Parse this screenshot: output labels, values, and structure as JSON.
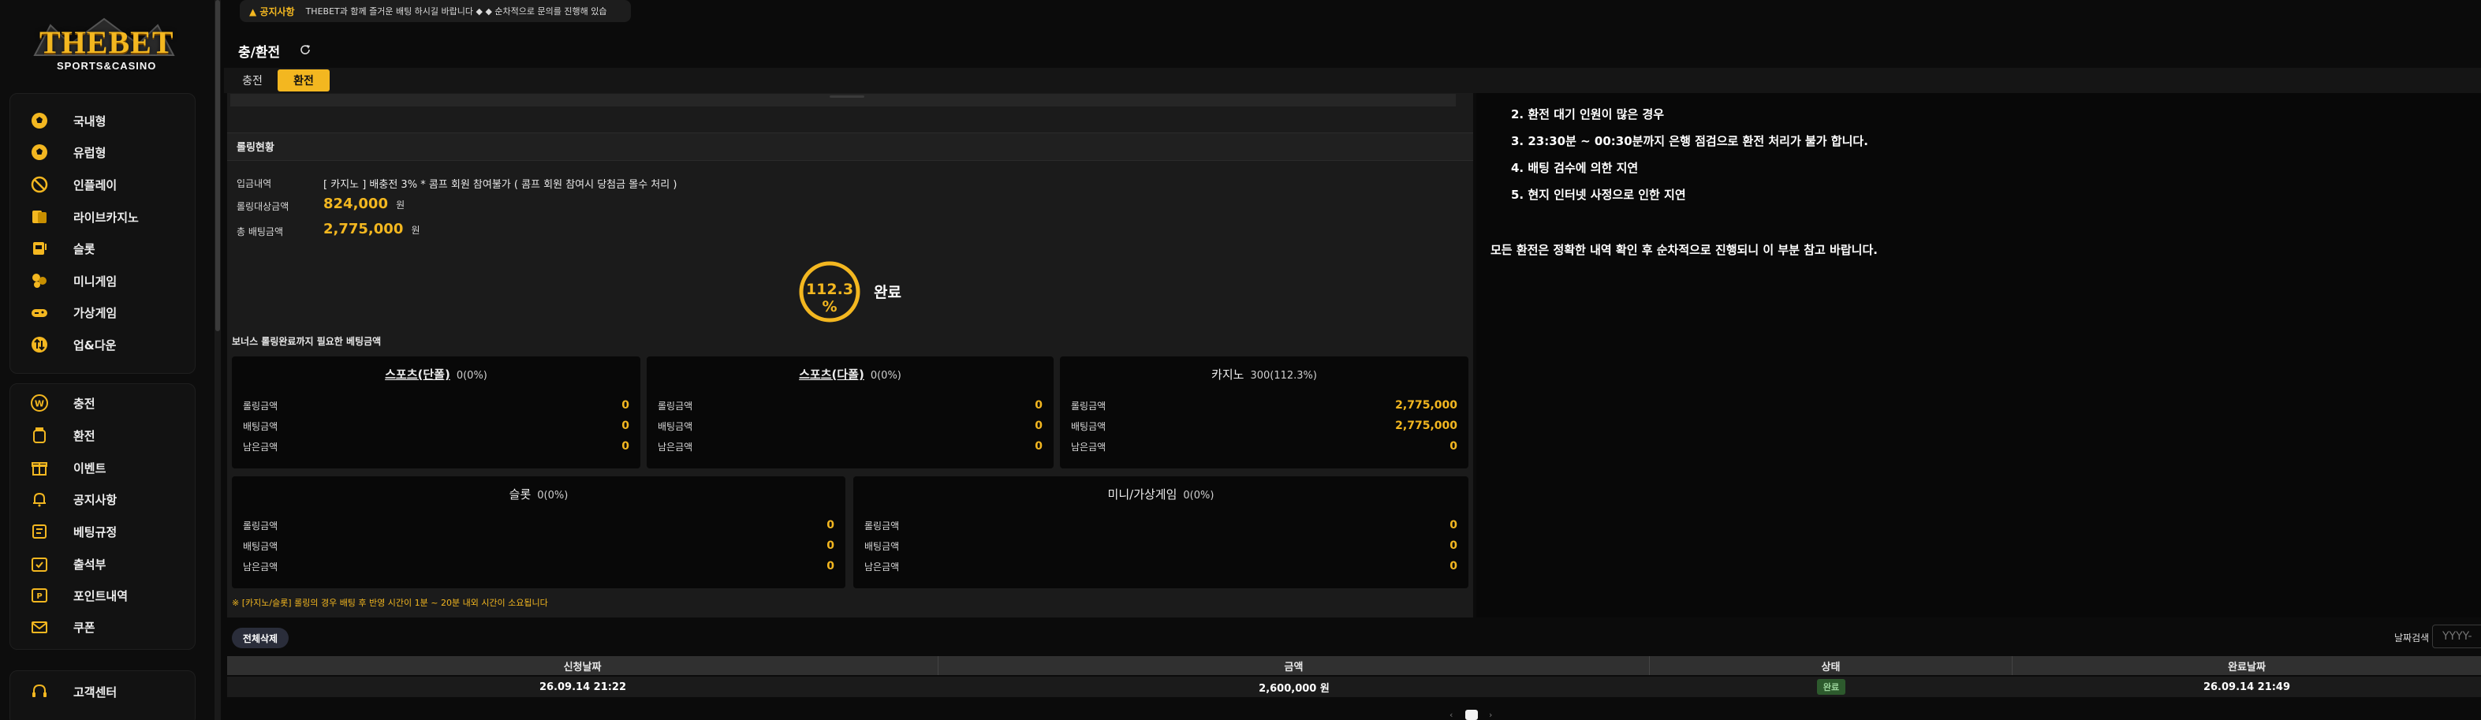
{
  "logo": {
    "title": "THEBET",
    "subtitle": "SPORTS&CASINO"
  },
  "sidebar": {
    "games": [
      {
        "label": "국내형",
        "icon": "soccer-ball-icon"
      },
      {
        "label": "유럽형",
        "icon": "soccer-ball-icon"
      },
      {
        "label": "인플레이",
        "icon": "no-sign-icon"
      },
      {
        "label": "라이브카지노",
        "icon": "cards-icon"
      },
      {
        "label": "슬롯",
        "icon": "slot-icon"
      },
      {
        "label": "미니게임",
        "icon": "balls-icon"
      },
      {
        "label": "가상게임",
        "icon": "gamepad-icon"
      },
      {
        "label": "업&다운",
        "icon": "updown-icon"
      }
    ],
    "account": [
      {
        "label": "충전",
        "icon": "won-coin-icon"
      },
      {
        "label": "환전",
        "icon": "jar-icon"
      },
      {
        "label": "이벤트",
        "icon": "gift-icon"
      },
      {
        "label": "공지사항",
        "icon": "bell-icon"
      },
      {
        "label": "베팅규정",
        "icon": "rules-icon"
      },
      {
        "label": "출석부",
        "icon": "calendar-check-icon"
      },
      {
        "label": "포인트내역",
        "icon": "point-icon"
      },
      {
        "label": "쿠폰",
        "icon": "mail-icon"
      }
    ],
    "support": [
      {
        "label": "고객센터",
        "icon": "headset-icon"
      }
    ]
  },
  "notice": {
    "tag": "공지사항",
    "text": "THEBET과 함께 즐거운 배팅 하시길 바랍니다 ◆ ◆ 순차적으로 문의를 진행해 있습"
  },
  "page": {
    "title": "충/환전",
    "tabs": {
      "deposit": "충전",
      "withdraw": "환전"
    }
  },
  "rolling": {
    "title": "롤링현황",
    "deposit_label": "입금내역",
    "deposit_value": "[ 카지노 ] 배충전 3% * 콤프 회원 참여불가 ( 콤프 회원 참여시 당첨금 몰수 처리 )",
    "target_label": "롤링대상금액",
    "target_value": "824,000",
    "total_label": "총 배팅금액",
    "total_value": "2,775,000",
    "won": "원",
    "progress_text": "112.3 %",
    "progress_fraction": 1.0,
    "status": "완료"
  },
  "bonus": {
    "title": "보너스 롤링완료까지 필요한 베팅금액",
    "row_labels": [
      "롤링금액",
      "배팅금액",
      "남은금액"
    ],
    "cards": [
      {
        "name": "스포츠(단폴)",
        "percent": "0(0%)",
        "values": [
          "0",
          "0",
          "0"
        ]
      },
      {
        "name": "스포츠(다폴)",
        "percent": "0(0%)",
        "values": [
          "0",
          "0",
          "0"
        ]
      },
      {
        "name": "카지노",
        "percent": "300(112.3%)",
        "values": [
          "2,775,000",
          "2,775,000",
          "0"
        ]
      },
      {
        "name": "슬롯",
        "percent": "0(0%)",
        "values": [
          "0",
          "0",
          "0"
        ]
      },
      {
        "name": "미니/가상게임",
        "percent": "0(0%)",
        "values": [
          "0",
          "0",
          "0"
        ]
      }
    ],
    "note": "※ [카지노/슬롯] 롤링의 경우 배팅 후 반영 시간이 1분 ~ 20분 내외 시간이 소요됩니다"
  },
  "rules": [
    "2. 환전 대기 인원이 많은 경우",
    "3. 23:30분 ~ 00:30분까지 은행 점검으로 환전 처리가 불가 합니다.",
    "4. 배팅 검수에 의한 지연",
    "5. 현지 인터넷 사정으로 인한 지연"
  ],
  "final_note": "모든 환전은 정확한 내역 확인 후 순차적으로 진행되니 이 부분 참고 바랍니다.",
  "history": {
    "button": "전체삭제",
    "date_label": "날짜검색",
    "date_placeholder": "YYYY-",
    "columns": [
      "신청날짜",
      "금액",
      "상태",
      "완료날짜"
    ],
    "row": {
      "date": "26.09.14 21:22",
      "amount": "2,600,000 원",
      "status": "완료",
      "done": "26.09.14 21:49"
    }
  },
  "colors": {
    "accent": "#f3b720",
    "background": "#0b0b0b",
    "panel": "#1b1b1b"
  }
}
